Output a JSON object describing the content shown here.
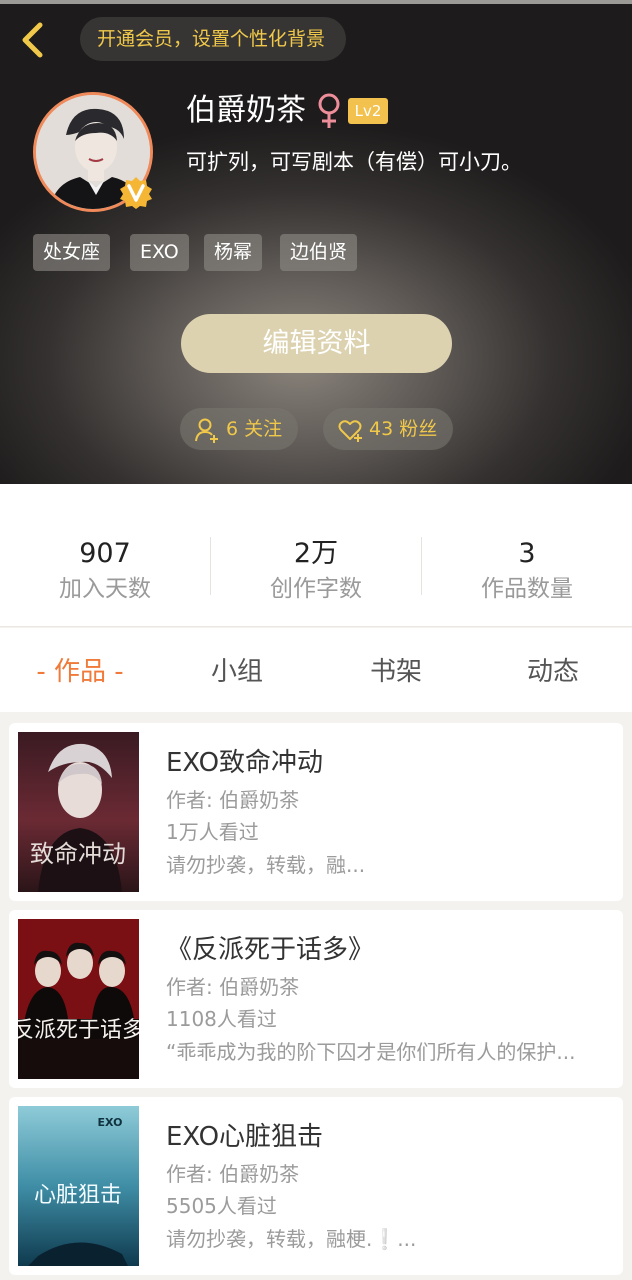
{
  "header": {
    "vip_banner": "开通会员，设置个性化背景",
    "username": "伯爵奶茶",
    "level": "Lv2",
    "bio": "可扩列，可写剧本（有偿）可小刀。",
    "tags": [
      "处女座",
      "EXO",
      "杨幂",
      "边伯贤"
    ],
    "edit_button": "编辑资料",
    "following": "6 关注",
    "followers": "43 粉丝",
    "accent_color": "#f0c84a"
  },
  "stats": [
    {
      "value": "907",
      "label": "加入天数"
    },
    {
      "value": "2万",
      "label": "创作字数"
    },
    {
      "value": "3",
      "label": "作品数量"
    }
  ],
  "tabs": [
    "- 作品 -",
    "小组",
    "书架",
    "动态"
  ],
  "active_tab_color": "#f07a3a",
  "works": [
    {
      "title": "EXO致命冲动",
      "author": "作者: 伯爵奶茶",
      "views": "1万人看过",
      "desc": "请勿抄袭，转载，融...",
      "cover_text": "致命冲动"
    },
    {
      "title": "《反派死于话多》",
      "author": "作者: 伯爵奶茶",
      "views": "1108人看过",
      "desc": "“乖乖成为我的阶下囚才是你们所有人的保护...",
      "cover_text": "反派死于话多"
    },
    {
      "title": "EXO心脏狙击",
      "author": "作者: 伯爵奶茶",
      "views": "5505人看过",
      "desc": "请勿抄袭，转载，融梗.❕...",
      "cover_text": "心脏狙击",
      "cover_logo": "EXO"
    }
  ]
}
